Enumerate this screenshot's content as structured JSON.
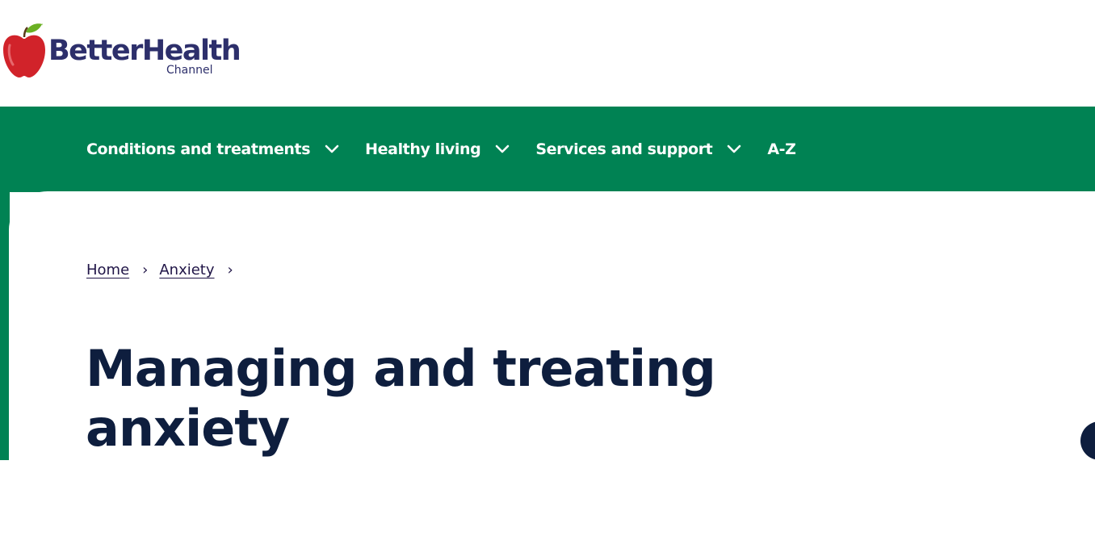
{
  "brand": {
    "name": "BetterHealth",
    "sub": "Channel",
    "colors": {
      "apple_red": "#d1232a",
      "leaf_green": "#6ab023",
      "text_navy": "#2d2f6b"
    }
  },
  "nav": {
    "background": "#008253",
    "items": [
      {
        "label": "Conditions and treatments",
        "icon": "chevron-down-icon"
      },
      {
        "label": "Healthy living",
        "icon": "chevron-down-icon"
      },
      {
        "label": "Services and support",
        "icon": "chevron-down-icon"
      },
      {
        "label": "A-Z"
      }
    ]
  },
  "breadcrumb": {
    "items": [
      {
        "label": "Home"
      },
      {
        "label": "Anxiety"
      }
    ],
    "separator": "›"
  },
  "page": {
    "title": "Managing and treating anxiety",
    "title_color": "#0e1e3e"
  }
}
